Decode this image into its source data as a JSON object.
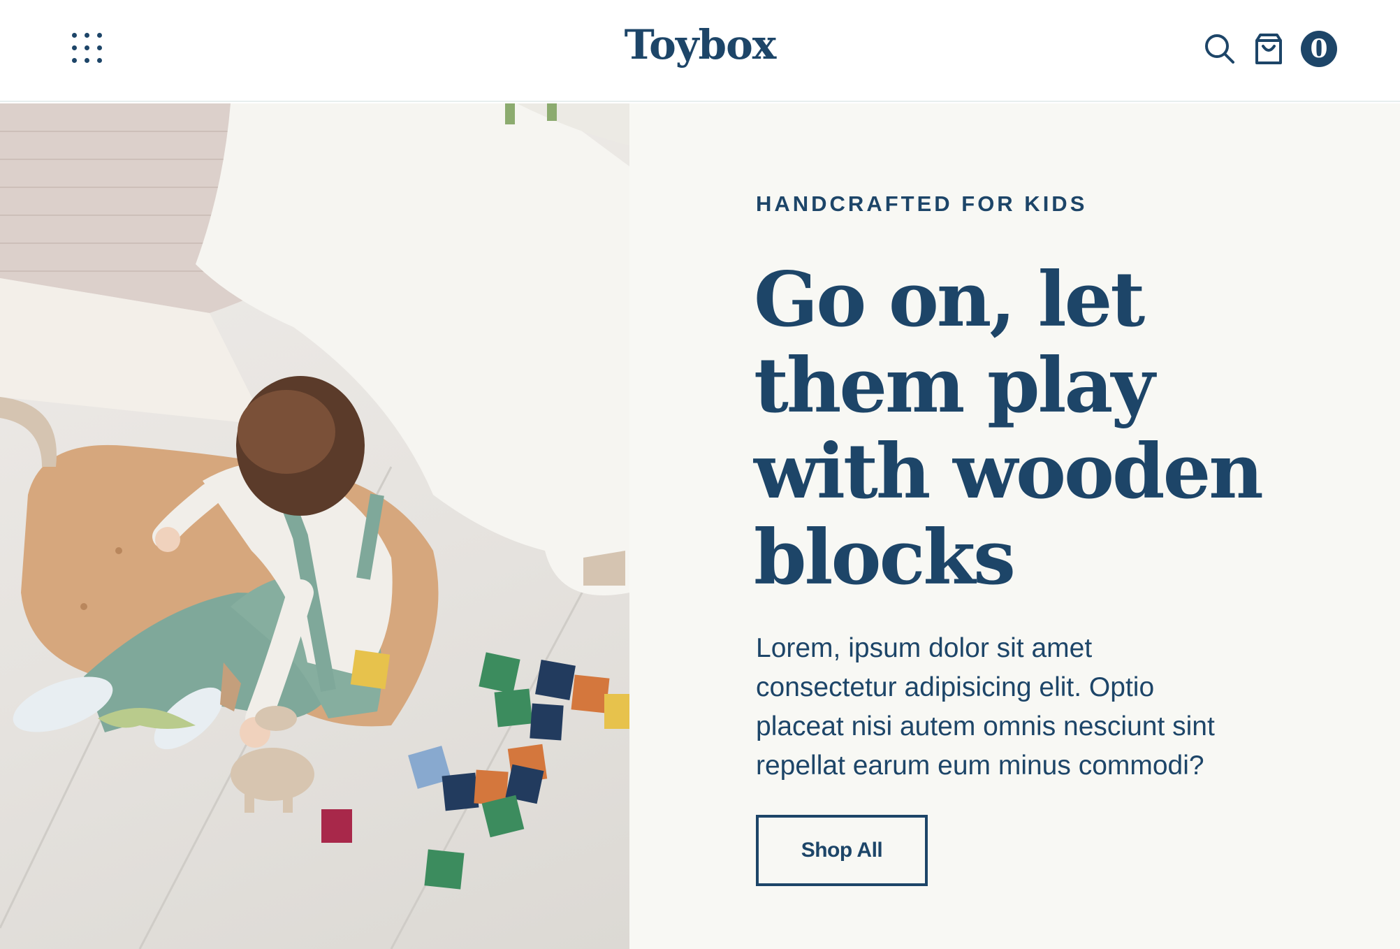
{
  "header": {
    "logo": "Toybox",
    "cart_count": "0",
    "icons": {
      "menu": "menu-dots-icon",
      "search": "search-icon",
      "cart": "shopping-bag-icon"
    }
  },
  "hero": {
    "eyebrow": "HANDCRAFTED FOR KIDS",
    "headline_lines": [
      "Go on, let",
      "them play",
      "with wooden",
      "blocks"
    ],
    "body_lines": [
      "Lorem, ipsum dolor sit amet",
      "consectetur adipisicing elit. Optio",
      "placeat nisi autem omnis nesciunt sint",
      "repellat earum eum minus commodi?"
    ],
    "cta_label": "Shop All"
  },
  "colors": {
    "brand": "#1d4568",
    "panel_background": "#f8f8f4",
    "header_background": "#ffffff"
  }
}
